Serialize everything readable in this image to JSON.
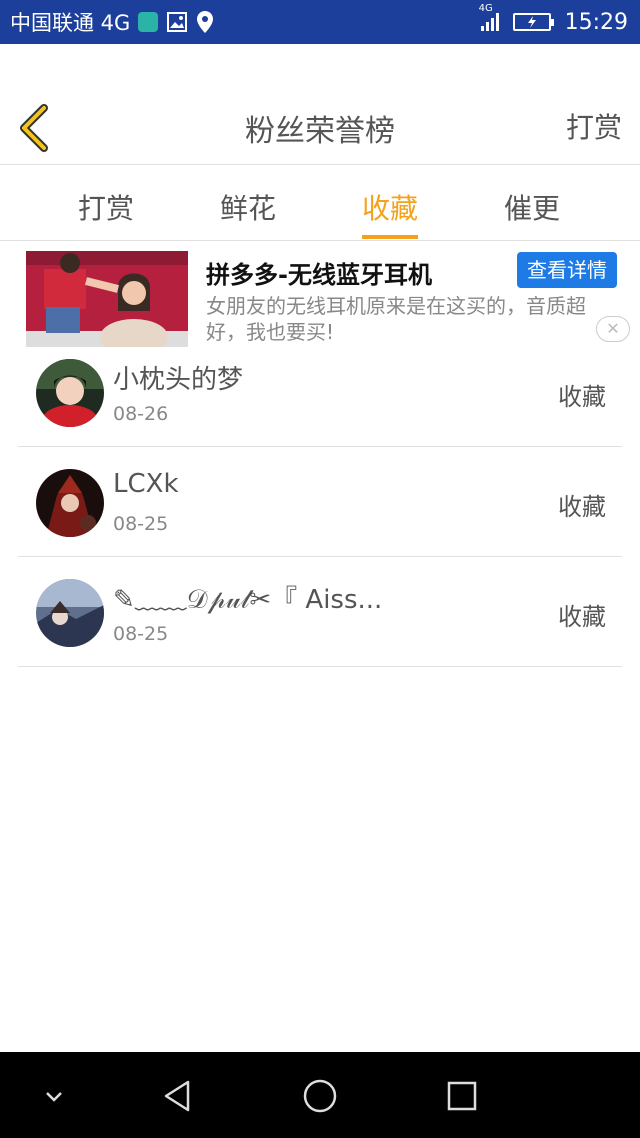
{
  "status_bar": {
    "carrier": "中国联通 4G",
    "network_badge": "4G",
    "time": "15:29",
    "icons": [
      "huawei-icon",
      "image-icon",
      "location-icon",
      "signal-icon",
      "battery-charging-icon"
    ]
  },
  "header": {
    "title": "粉丝荣誉榜",
    "action": "打赏",
    "back_icon": "chevron-left-icon"
  },
  "tabs": [
    {
      "label": "打赏",
      "active": false
    },
    {
      "label": "鲜花",
      "active": false
    },
    {
      "label": "收藏",
      "active": true
    },
    {
      "label": "催更",
      "active": false
    }
  ],
  "ad": {
    "title": "拼多多-无线蓝牙耳机",
    "button": "查看详情",
    "description": "女朋友的无线耳机原来是在这买的，音质超好，我也要买!",
    "close_icon": "close-icon"
  },
  "list": [
    {
      "name": "小枕头的梦",
      "date": "08-26",
      "action": "收藏"
    },
    {
      "name": "LCXk",
      "date": "08-25",
      "action": "收藏"
    },
    {
      "name": "✎﹏﹏𝒟𝓅𝓊𝓁✂『 Aiss...",
      "date": "08-25",
      "action": "收藏"
    }
  ],
  "nav_bar": {
    "icons": [
      "chevron-down-icon",
      "back-triangle-icon",
      "home-circle-icon",
      "recents-square-icon"
    ]
  },
  "colors": {
    "status_bar": "#1c3f9c",
    "accent": "#f4a21c",
    "ad_button": "#1e7be6",
    "back_icon": "#f4c41c"
  }
}
